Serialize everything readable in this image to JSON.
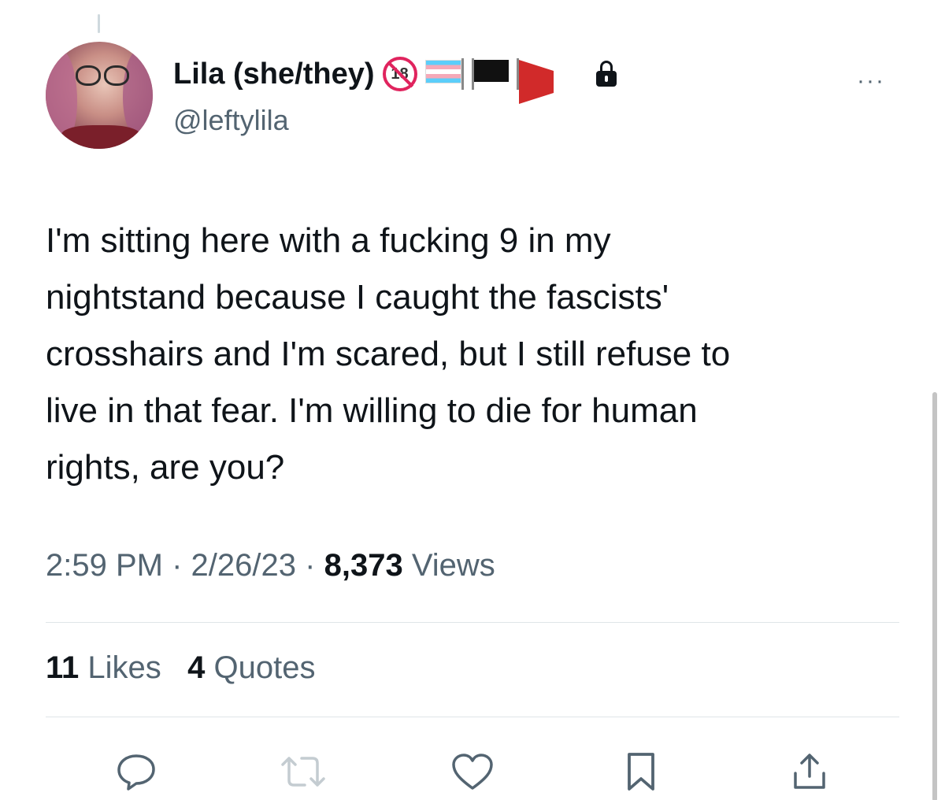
{
  "tweet": {
    "author": {
      "display_name": "Lila (she/they)",
      "handle": "@leftylila",
      "badges": [
        "no-18-icon",
        "transgender-flag-icon",
        "black-flag-icon",
        "triangular-red-flag-icon",
        "lock-icon"
      ]
    },
    "no18_label": "18",
    "more_label": "···",
    "text": "I'm sitting here with a fucking 9 in my\nnightstand because I caught the fascists'\ncrosshairs and I'm scared, but I still refuse to\nlive in that fear. I'm willing to die for human\nrights, are you?",
    "time": "2:59 PM",
    "date": "2/26/23",
    "separator": "·",
    "views_count": "8,373",
    "views_label": "Views",
    "likes_count": "11",
    "likes_label": "Likes",
    "quotes_count": "4",
    "quotes_label": "Quotes"
  },
  "actions": [
    "reply-icon",
    "retweet-icon",
    "like-icon",
    "bookmark-icon",
    "share-icon"
  ],
  "colors": {
    "text_primary": "#0f1419",
    "text_secondary": "#536471",
    "divider": "#dfe5e8",
    "icon": "#536471",
    "retweet_icon": "#c4ccd1"
  }
}
